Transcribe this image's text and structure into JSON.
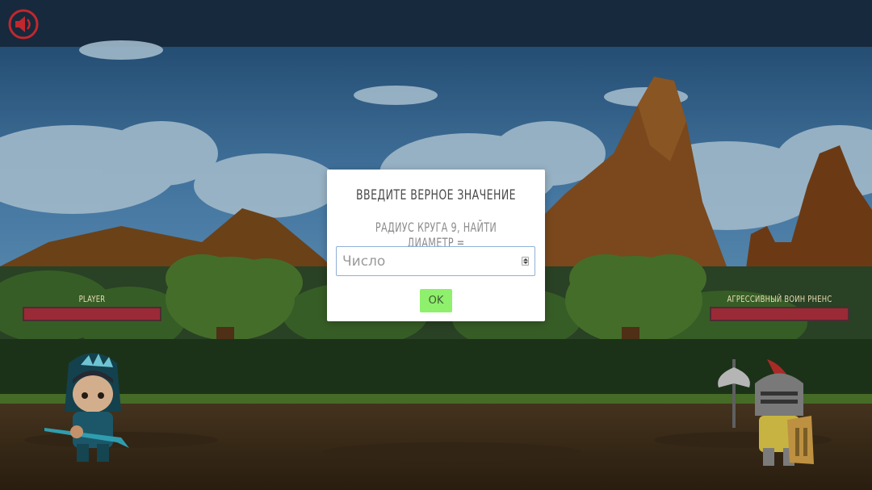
{
  "player": {
    "name": "Player",
    "hp": 1.0
  },
  "enemy": {
    "name": "Агрессивный воин Рненс",
    "hp": 1.0
  },
  "modal": {
    "title": "Введите верное значение",
    "question": "Радиус круга 9, найти диаметр =",
    "input_value": "",
    "input_placeholder": "Число",
    "ok_label": "OK"
  },
  "icons": {
    "sound": "speaker-icon"
  },
  "colors": {
    "hp_bar": "#9a2a36",
    "ok_button": "#8ef06c",
    "sound_icon": "#c2272d"
  }
}
